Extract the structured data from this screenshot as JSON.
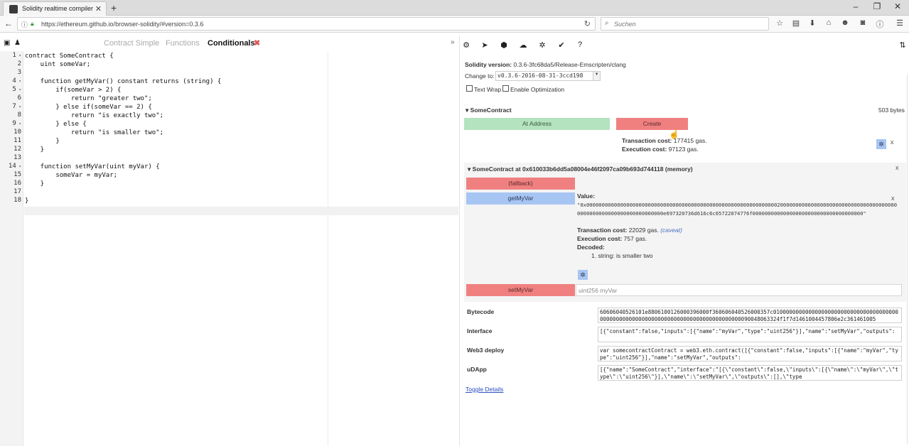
{
  "browser": {
    "tab_title": "Solidity realtime compiler ...",
    "url": "https://ethereum.github.io/browser-solidity/#version=0.3.6",
    "search_placeholder": "Suchen"
  },
  "editor": {
    "tabs": [
      {
        "label": "Contract Simple",
        "active": false
      },
      {
        "label": "Functions",
        "active": false
      },
      {
        "label": "Conditionals",
        "active": true
      }
    ],
    "tab_close": "✖",
    "lines": [
      {
        "n": "1",
        "fold": true,
        "code": "contract SomeContract {"
      },
      {
        "n": "2",
        "fold": false,
        "code": "    uint someVar;"
      },
      {
        "n": "3",
        "fold": false,
        "code": ""
      },
      {
        "n": "4",
        "fold": true,
        "code": "    function getMyVar() constant returns (string) {"
      },
      {
        "n": "5",
        "fold": true,
        "code": "        if(someVar > 2) {"
      },
      {
        "n": "6",
        "fold": false,
        "code": "            return \"greater two\";"
      },
      {
        "n": "7",
        "fold": true,
        "code": "        } else if(someVar == 2) {"
      },
      {
        "n": "8",
        "fold": false,
        "code": "            return \"is exactly two\";"
      },
      {
        "n": "9",
        "fold": true,
        "code": "        } else {"
      },
      {
        "n": "10",
        "fold": false,
        "code": "            return \"is smaller two\";"
      },
      {
        "n": "11",
        "fold": false,
        "code": "        }"
      },
      {
        "n": "12",
        "fold": false,
        "code": "    }"
      },
      {
        "n": "13",
        "fold": false,
        "code": ""
      },
      {
        "n": "14",
        "fold": true,
        "code": "    function setMyVar(uint myVar) {"
      },
      {
        "n": "15",
        "fold": false,
        "code": "        someVar = myVar;"
      },
      {
        "n": "16",
        "fold": false,
        "code": "    }"
      },
      {
        "n": "17",
        "fold": false,
        "code": ""
      },
      {
        "n": "18",
        "fold": false,
        "code": "}"
      }
    ]
  },
  "panel": {
    "solidity_version_label": "Solidity version:",
    "solidity_version_value": "0.3.6-3fc68da5/Release-Emscripten/clang",
    "change_to_label": "Change to:",
    "change_to_value": "v0.3.6-2016-08-31-3ccd198",
    "text_wrap": "Text Wrap",
    "enable_optimization": "Enable Optimization",
    "contract_name": "SomeContract",
    "contract_size": "503 bytes",
    "at_address": "At Address",
    "create": "Create",
    "tx_cost_label": "Transaction cost:",
    "tx_cost_value": "177415 gas.",
    "exec_cost_label": "Execution cost:",
    "exec_cost_value": "97123 gas.",
    "instance_title": "SomeContract at 0x610033b6dd5a08004e46f2097ca09b693d744118 (memory)",
    "fallback": "(fallback)",
    "getmyvar": "getMyVar",
    "value_label": "Value:",
    "value_hex": "\"0x000000000000000000000000000000000000000000000000000000000000002000000000000000000000000000000000000000000000000000000000000000000e697320736d616c6c65722074776f000000000000000000000000000000000000\"",
    "call_tx_cost_label": "Transaction cost:",
    "call_tx_cost_value": "22029 gas.",
    "caveat": "(caveat)",
    "call_exec_cost_label": "Execution cost:",
    "call_exec_cost_value": "757 gas.",
    "decoded_label": "Decoded:",
    "decoded_item": "1. string: is smaller two",
    "setmyvar": "setMyVar",
    "setmyvar_placeholder": "uint256 myVar",
    "bytecode_label": "Bytecode",
    "bytecode_value": "60606040526101e8806100126000396000f360606040526000357c01000000000000000000000000000000000000000000000000000000000000000000000000000000000090048063324f1f7d1461004457806e2c361461005",
    "interface_label": "Interface",
    "interface_value": "[{\"constant\":false,\"inputs\":[{\"name\":\"myVar\",\"type\":\"uint256\"}],\"name\":\"setMyVar\",\"outputs\":",
    "web3_label": "Web3 deploy",
    "web3_value": "var somecontractContract = web3.eth.contract([{\"constant\":false,\"inputs\":[{\"name\":\"myVar\",\"type\":\"uint256\"}],\"name\":\"setMyVar\",\"outputs\":",
    "udapp_label": "uDApp",
    "udapp_value": "[{\"name\":\"SomeContract\",\"interface\":\"[{\\\"constant\\\":false,\\\"inputs\\\":[{\\\"name\\\":\\\"myVar\\\",\\\"type\\\":\\\"uint256\\\"}],\\\"name\\\":\\\"setMyVar\\\",\\\"outputs\\\":[],\\\"type",
    "toggle_details": "Toggle Details",
    "close": "x"
  }
}
